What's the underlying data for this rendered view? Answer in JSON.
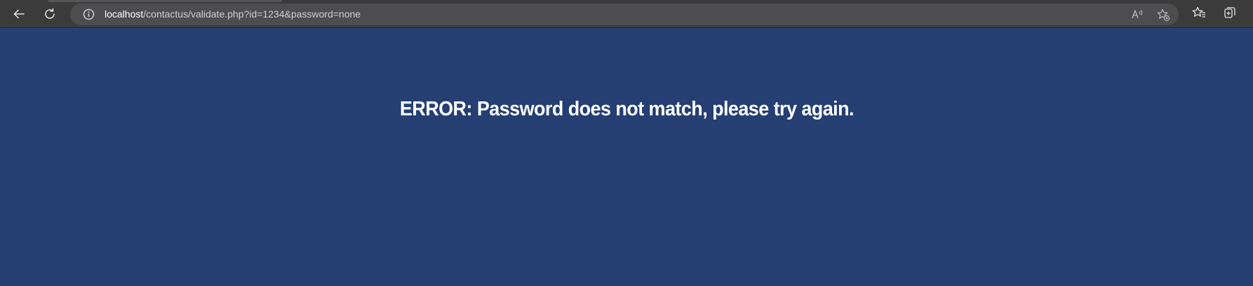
{
  "browser": {
    "url": {
      "host": "localhost",
      "path": "/contactus/validate.php?id=1234&password=none"
    },
    "icons": {
      "back": "back-arrow-icon",
      "refresh": "refresh-icon",
      "site_info": "info-icon",
      "read_aloud": "read-aloud-icon",
      "add_favorite": "add-favorite-icon",
      "favorites": "favorites-icon",
      "collections": "collections-icon"
    },
    "colors": {
      "toolbar": "#3b3b3b",
      "address_bar": "#4d4d4f"
    }
  },
  "page": {
    "background": "#253f73",
    "message": "ERROR: Password does not match, please try again."
  }
}
